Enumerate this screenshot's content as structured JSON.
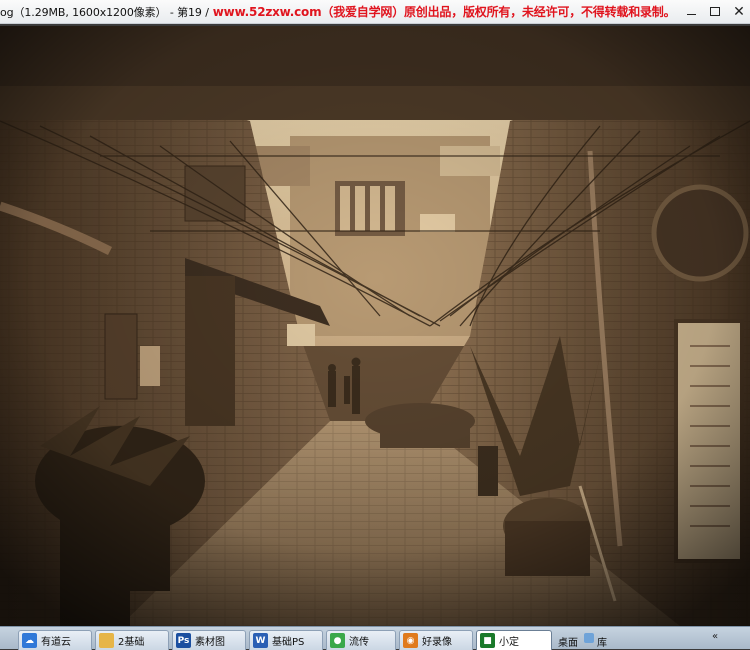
{
  "window": {
    "title_file": "og（1.29MB, 1600x1200像素） - 第19 /",
    "title_banner": "www.52zxw.com（我爱自学网）原创出品，版权所有，未经许可，不得转载和录制。",
    "controls": {
      "minimize": "minimize",
      "maximize": "maximize",
      "close": "✕"
    }
  },
  "colors": {
    "banner": "#e0141e",
    "sepia_light": "#e8d2a8",
    "sepia_dark": "#2a1e14"
  },
  "taskbar": {
    "items": [
      {
        "label": "有道云",
        "icon": "youdao-cloud-icon",
        "color": "#2f78d8",
        "glyph": "☁"
      },
      {
        "label": "2基础",
        "icon": "folder-icon",
        "color": "#e6b548",
        "glyph": ""
      },
      {
        "label": "素材图",
        "icon": "photoshop-icon",
        "color": "#1b4fa0",
        "glyph": "Ps"
      },
      {
        "label": "基础PS",
        "icon": "word-icon",
        "color": "#2a5fb4",
        "glyph": "W"
      },
      {
        "label": "流传",
        "icon": "green-app-icon",
        "color": "#3aa84a",
        "glyph": "●"
      },
      {
        "label": "好录像",
        "icon": "recorder-icon",
        "color": "#e07a1c",
        "glyph": "◉"
      },
      {
        "label": "小定",
        "icon": "terminal-icon",
        "color": "#1a7a2a",
        "glyph": "■"
      }
    ],
    "desktop_label": "桌面",
    "tray_app": "库",
    "expand": "«"
  }
}
